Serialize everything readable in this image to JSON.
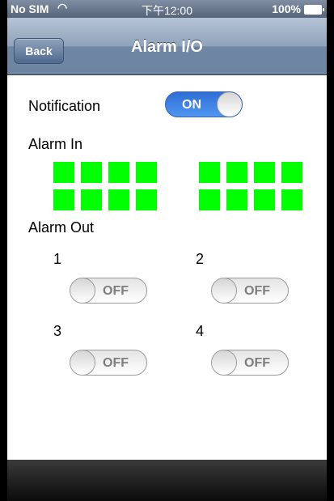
{
  "status_bar": {
    "carrier": "No SIM",
    "wifi_icon": "wifi-icon",
    "time": "下午12:00",
    "battery": "100%"
  },
  "nav": {
    "back_label": "Back",
    "title": "Alarm I/O"
  },
  "notification": {
    "label": "Notification",
    "toggle": "ON"
  },
  "alarm_in": {
    "label": "Alarm In",
    "indicator_color": "#00ff00",
    "group_count": 2
  },
  "alarm_out": {
    "label": "Alarm Out",
    "outputs": [
      {
        "number": "1",
        "state": "OFF"
      },
      {
        "number": "2",
        "state": "OFF"
      },
      {
        "number": "3",
        "state": "OFF"
      },
      {
        "number": "4",
        "state": "OFF"
      }
    ]
  }
}
